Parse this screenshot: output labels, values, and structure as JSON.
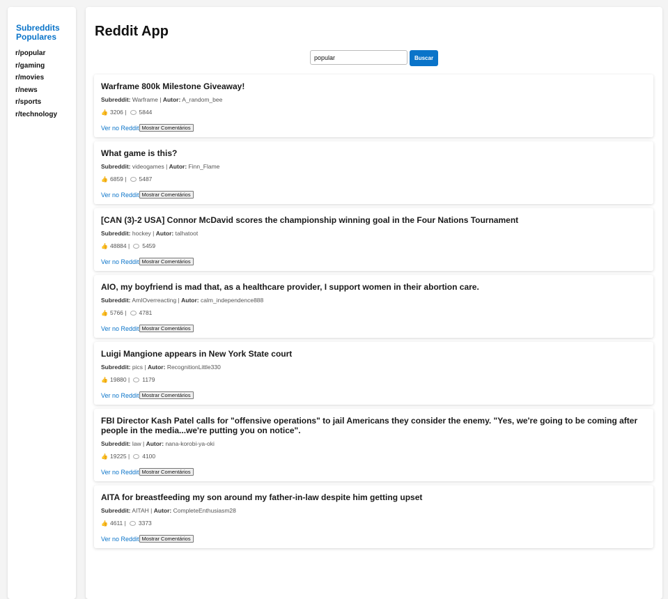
{
  "sidebar": {
    "title": "Subreddits Populares",
    "items": [
      "r/popular",
      "r/gaming",
      "r/movies",
      "r/news",
      "r/sports",
      "r/technology"
    ]
  },
  "app_title": "Reddit App",
  "search": {
    "value": "popular",
    "button_label": "Buscar"
  },
  "labels": {
    "subreddit": "Subreddit:",
    "author": "Autor:",
    "view_link": "Ver no Reddit",
    "comments_button": "Mostrar Comentários"
  },
  "posts": [
    {
      "title": "Warframe 800k Milestone Giveaway!",
      "subreddit": "Warframe",
      "author": "A_random_bee",
      "score": "3206",
      "comments": "5844"
    },
    {
      "title": "What game is this?",
      "subreddit": "videogames",
      "author": "Finn_Flame",
      "score": "6859",
      "comments": "5487"
    },
    {
      "title": "[CAN (3)-2 USA] Connor McDavid scores the championship winning goal in the Four Nations Tournament",
      "subreddit": "hockey",
      "author": "talhatoot",
      "score": "48884",
      "comments": "5459"
    },
    {
      "title": "AIO, my boyfriend is mad that, as a healthcare provider, I support women in their abortion care.",
      "subreddit": "AmIOverreacting",
      "author": "calm_independence888",
      "score": "5766",
      "comments": "4781"
    },
    {
      "title": "Luigi Mangione appears in New York State court",
      "subreddit": "pics",
      "author": "RecognitionLittle330",
      "score": "19880",
      "comments": "1179"
    },
    {
      "title": "FBI Director Kash Patel calls for \"offensive operations\" to jail Americans they consider the enemy. \"Yes, we're going to be coming after people in the media...we're putting you on notice\".",
      "subreddit": "law",
      "author": "nana-korobi-ya-oki",
      "score": "19225",
      "comments": "4100"
    },
    {
      "title": "AITA for breastfeeding my son around my father-in-law despite him getting upset",
      "subreddit": "AITAH",
      "author": "CompleteEnthusiasm28",
      "score": "4611",
      "comments": "3373"
    }
  ],
  "colors": {
    "accent": "#0a74c9",
    "thumb": "#e09a1b"
  },
  "icons": {
    "score": "thumbs-up-icon",
    "comments": "comment-bubble-icon"
  }
}
